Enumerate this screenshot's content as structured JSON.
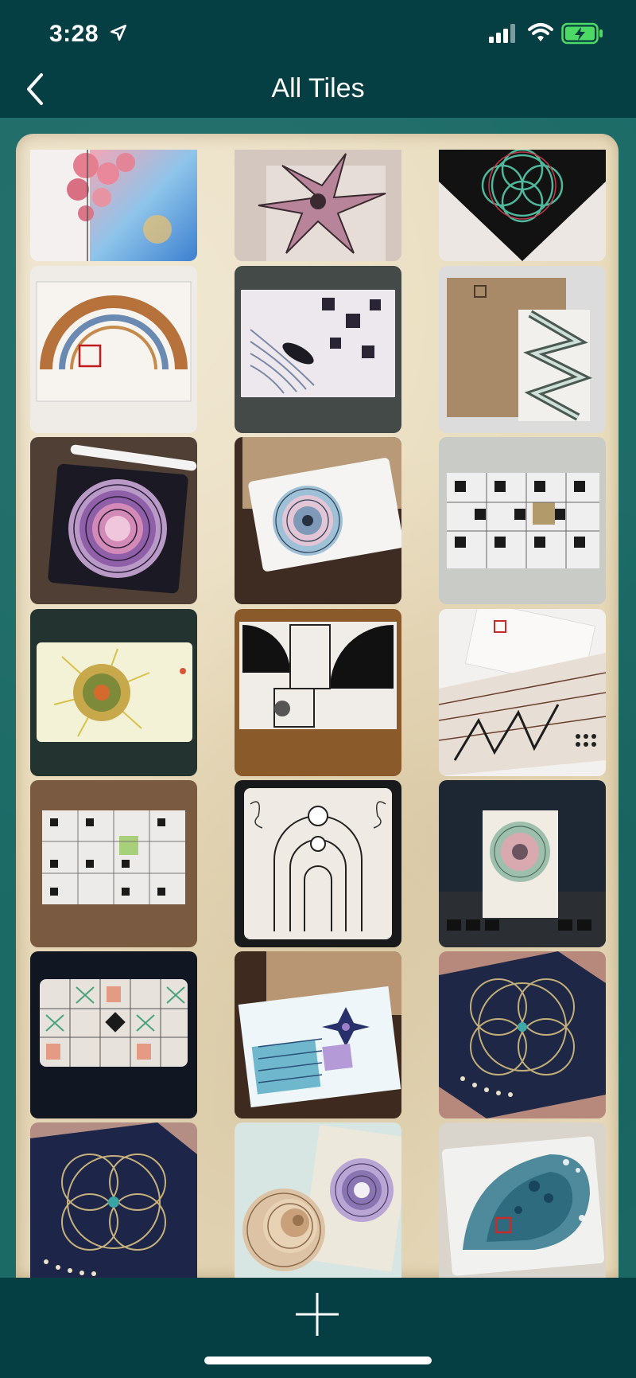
{
  "status_bar": {
    "time": "3:28",
    "icons": [
      "location-arrow-icon",
      "cellular-signal-icon",
      "wifi-icon",
      "battery-charging-icon"
    ],
    "battery_color": "#4cd964"
  },
  "nav": {
    "title": "All Tiles",
    "back_icon": "chevron-left-icon"
  },
  "grid": {
    "columns": 3,
    "tiles": [
      {
        "name": "tile-1"
      },
      {
        "name": "tile-2"
      },
      {
        "name": "tile-3"
      },
      {
        "name": "tile-4"
      },
      {
        "name": "tile-5"
      },
      {
        "name": "tile-6"
      },
      {
        "name": "tile-7"
      },
      {
        "name": "tile-8"
      },
      {
        "name": "tile-9"
      },
      {
        "name": "tile-10"
      },
      {
        "name": "tile-11"
      },
      {
        "name": "tile-12"
      },
      {
        "name": "tile-13"
      },
      {
        "name": "tile-14"
      },
      {
        "name": "tile-15"
      },
      {
        "name": "tile-16"
      },
      {
        "name": "tile-17"
      },
      {
        "name": "tile-18"
      },
      {
        "name": "tile-19"
      },
      {
        "name": "tile-20"
      },
      {
        "name": "tile-21"
      }
    ]
  },
  "bottom_bar": {
    "add_icon": "plus-icon"
  },
  "colors": {
    "header": "#053e43",
    "background_teal": "#1b6a66",
    "parchment": "#e9dcbd"
  }
}
